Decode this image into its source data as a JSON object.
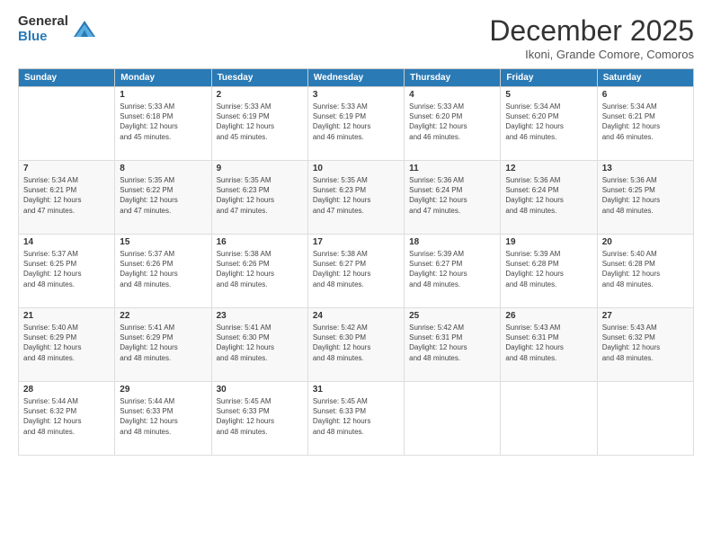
{
  "logo": {
    "general": "General",
    "blue": "Blue"
  },
  "title": "December 2025",
  "subtitle": "Ikoni, Grande Comore, Comoros",
  "days_header": [
    "Sunday",
    "Monday",
    "Tuesday",
    "Wednesday",
    "Thursday",
    "Friday",
    "Saturday"
  ],
  "weeks": [
    [
      {
        "day": null,
        "info": null
      },
      {
        "day": "1",
        "sunrise": "5:33 AM",
        "sunset": "6:18 PM",
        "daylight": "12 hours and 45 minutes."
      },
      {
        "day": "2",
        "sunrise": "5:33 AM",
        "sunset": "6:19 PM",
        "daylight": "12 hours and 45 minutes."
      },
      {
        "day": "3",
        "sunrise": "5:33 AM",
        "sunset": "6:19 PM",
        "daylight": "12 hours and 46 minutes."
      },
      {
        "day": "4",
        "sunrise": "5:33 AM",
        "sunset": "6:20 PM",
        "daylight": "12 hours and 46 minutes."
      },
      {
        "day": "5",
        "sunrise": "5:34 AM",
        "sunset": "6:20 PM",
        "daylight": "12 hours and 46 minutes."
      },
      {
        "day": "6",
        "sunrise": "5:34 AM",
        "sunset": "6:21 PM",
        "daylight": "12 hours and 46 minutes."
      }
    ],
    [
      {
        "day": "7",
        "sunrise": "5:34 AM",
        "sunset": "6:21 PM",
        "daylight": "12 hours and 47 minutes."
      },
      {
        "day": "8",
        "sunrise": "5:35 AM",
        "sunset": "6:22 PM",
        "daylight": "12 hours and 47 minutes."
      },
      {
        "day": "9",
        "sunrise": "5:35 AM",
        "sunset": "6:23 PM",
        "daylight": "12 hours and 47 minutes."
      },
      {
        "day": "10",
        "sunrise": "5:35 AM",
        "sunset": "6:23 PM",
        "daylight": "12 hours and 47 minutes."
      },
      {
        "day": "11",
        "sunrise": "5:36 AM",
        "sunset": "6:24 PM",
        "daylight": "12 hours and 47 minutes."
      },
      {
        "day": "12",
        "sunrise": "5:36 AM",
        "sunset": "6:24 PM",
        "daylight": "12 hours and 48 minutes."
      },
      {
        "day": "13",
        "sunrise": "5:36 AM",
        "sunset": "6:25 PM",
        "daylight": "12 hours and 48 minutes."
      }
    ],
    [
      {
        "day": "14",
        "sunrise": "5:37 AM",
        "sunset": "6:25 PM",
        "daylight": "12 hours and 48 minutes."
      },
      {
        "day": "15",
        "sunrise": "5:37 AM",
        "sunset": "6:26 PM",
        "daylight": "12 hours and 48 minutes."
      },
      {
        "day": "16",
        "sunrise": "5:38 AM",
        "sunset": "6:26 PM",
        "daylight": "12 hours and 48 minutes."
      },
      {
        "day": "17",
        "sunrise": "5:38 AM",
        "sunset": "6:27 PM",
        "daylight": "12 hours and 48 minutes."
      },
      {
        "day": "18",
        "sunrise": "5:39 AM",
        "sunset": "6:27 PM",
        "daylight": "12 hours and 48 minutes."
      },
      {
        "day": "19",
        "sunrise": "5:39 AM",
        "sunset": "6:28 PM",
        "daylight": "12 hours and 48 minutes."
      },
      {
        "day": "20",
        "sunrise": "5:40 AM",
        "sunset": "6:28 PM",
        "daylight": "12 hours and 48 minutes."
      }
    ],
    [
      {
        "day": "21",
        "sunrise": "5:40 AM",
        "sunset": "6:29 PM",
        "daylight": "12 hours and 48 minutes."
      },
      {
        "day": "22",
        "sunrise": "5:41 AM",
        "sunset": "6:29 PM",
        "daylight": "12 hours and 48 minutes."
      },
      {
        "day": "23",
        "sunrise": "5:41 AM",
        "sunset": "6:30 PM",
        "daylight": "12 hours and 48 minutes."
      },
      {
        "day": "24",
        "sunrise": "5:42 AM",
        "sunset": "6:30 PM",
        "daylight": "12 hours and 48 minutes."
      },
      {
        "day": "25",
        "sunrise": "5:42 AM",
        "sunset": "6:31 PM",
        "daylight": "12 hours and 48 minutes."
      },
      {
        "day": "26",
        "sunrise": "5:43 AM",
        "sunset": "6:31 PM",
        "daylight": "12 hours and 48 minutes."
      },
      {
        "day": "27",
        "sunrise": "5:43 AM",
        "sunset": "6:32 PM",
        "daylight": "12 hours and 48 minutes."
      }
    ],
    [
      {
        "day": "28",
        "sunrise": "5:44 AM",
        "sunset": "6:32 PM",
        "daylight": "12 hours and 48 minutes."
      },
      {
        "day": "29",
        "sunrise": "5:44 AM",
        "sunset": "6:33 PM",
        "daylight": "12 hours and 48 minutes."
      },
      {
        "day": "30",
        "sunrise": "5:45 AM",
        "sunset": "6:33 PM",
        "daylight": "12 hours and 48 minutes."
      },
      {
        "day": "31",
        "sunrise": "5:45 AM",
        "sunset": "6:33 PM",
        "daylight": "12 hours and 48 minutes."
      },
      {
        "day": null,
        "info": null
      },
      {
        "day": null,
        "info": null
      },
      {
        "day": null,
        "info": null
      }
    ]
  ],
  "labels": {
    "sunrise": "Sunrise:",
    "sunset": "Sunset:",
    "daylight": "Daylight:"
  }
}
